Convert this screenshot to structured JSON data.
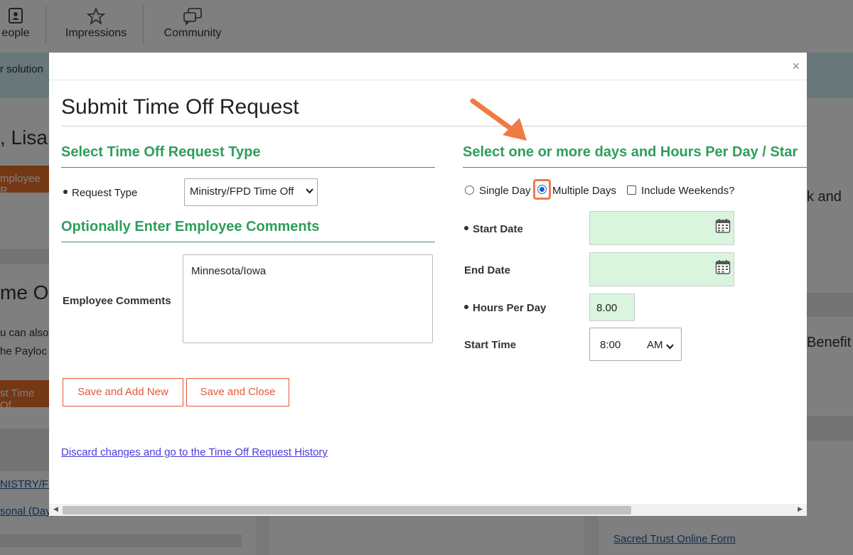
{
  "background": {
    "nav": [
      {
        "label": "People",
        "shown": "eople",
        "icon": "person-card-icon"
      },
      {
        "label": "Impressions",
        "icon": "star-icon"
      },
      {
        "label": "Community",
        "icon": "chat-bubbles-icon"
      }
    ],
    "banner_text": "r solution",
    "greeting": ", Lisa!",
    "employee_button": "mployee R",
    "section_title": "me Of",
    "text_line1": "u can also",
    "text_line2": "he Payloc",
    "time_off_button": "st Time Of",
    "link_ministry": "NISTRY/FF",
    "link_personal": "sonal (Day)",
    "right_text1": "k and",
    "right_text2": "Benefit",
    "sacred_trust_link": "Sacred Trust Online Form",
    "benefits_text": "Benefits"
  },
  "modal": {
    "title": "Submit Time Off Request",
    "close_label": "×",
    "left": {
      "type_heading": "Select Time Off Request Type",
      "request_type_label": "Request Type",
      "request_type_value": "Ministry/FPD Time Off",
      "comments_heading": "Optionally Enter Employee Comments",
      "comments_label": "Employee Comments",
      "comments_value": "Minnesota/Iowa",
      "save_add_new": "Save and Add New",
      "save_close": "Save and Close",
      "discard_link": "Discard changes and go to the Time Off Request History"
    },
    "right": {
      "heading": "Select one or more days and Hours Per Day / Star",
      "single_day": "Single Day",
      "multiple_days": "Multiple Days",
      "include_weekends": "Include Weekends?",
      "selected_option": "Multiple Days",
      "start_date_label": "Start Date",
      "start_date_value": "",
      "end_date_label": "End Date",
      "end_date_value": "",
      "hours_label": "Hours Per Day",
      "hours_value": "8.00",
      "start_time_label": "Start Time",
      "start_time_value": "8:00",
      "ampm_value": "AM"
    }
  },
  "colors": {
    "accent_green": "#2e9e5b",
    "highlight_orange": "#f07a43",
    "button_red": "#e8553a",
    "date_fill": "#d9f5dd",
    "link_blue": "#4a3ad8"
  }
}
